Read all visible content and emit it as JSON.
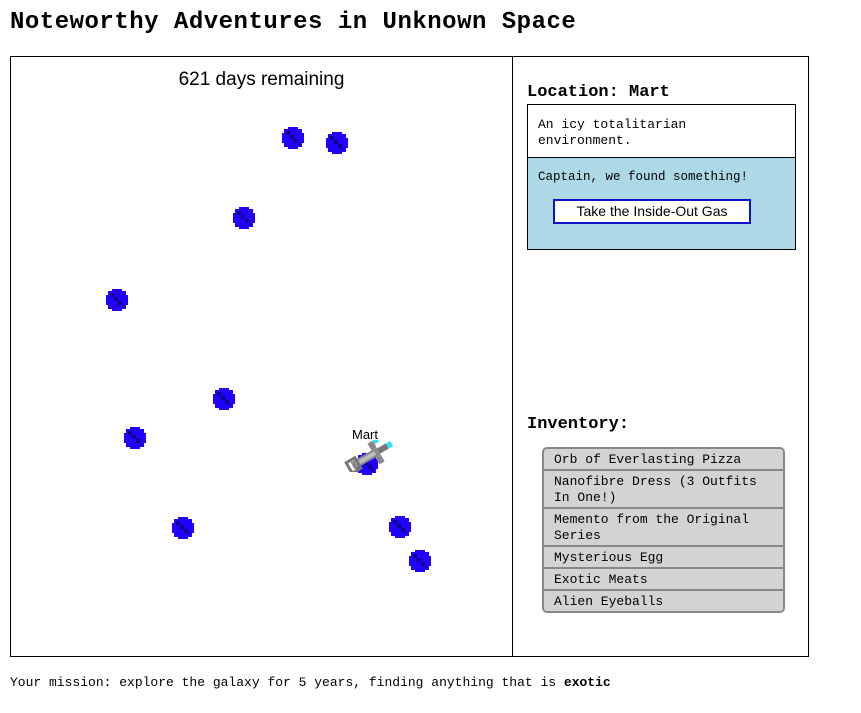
{
  "game": {
    "title": "Noteworthy Adventures in Unknown Space"
  },
  "status": {
    "days_remaining": "621 days remaining"
  },
  "map": {
    "planets": [
      {
        "id": "p1"
      },
      {
        "id": "p2"
      },
      {
        "id": "p3"
      },
      {
        "id": "p4"
      },
      {
        "id": "p5"
      },
      {
        "id": "p6"
      },
      {
        "id": "p7"
      },
      {
        "id": "p8"
      },
      {
        "id": "p9"
      },
      {
        "id": "p10"
      },
      {
        "id": "p11",
        "label": "Mart",
        "current": true
      }
    ],
    "planet_color": "#2200ff",
    "planet_shadow_color": "#110088"
  },
  "location": {
    "heading": "Location: Mart",
    "description": "An icy totalitarian environment.",
    "found_message": "Captain, we found something!",
    "take_button_label": "Take the Inside-Out Gas",
    "panel_color": "#add8e6"
  },
  "inventory": {
    "heading": "Inventory:",
    "items": [
      "Orb of Everlasting Pizza",
      "Nanofibre Dress (3 Outfits In One!)",
      "Memento from the Original Series",
      "Mysterious Egg",
      "Exotic Meats",
      "Alien Eyeballs"
    ]
  },
  "mission": {
    "prefix": "Your mission: explore the galaxy for 5 years, finding anything that is ",
    "emphasis": "exotic"
  }
}
